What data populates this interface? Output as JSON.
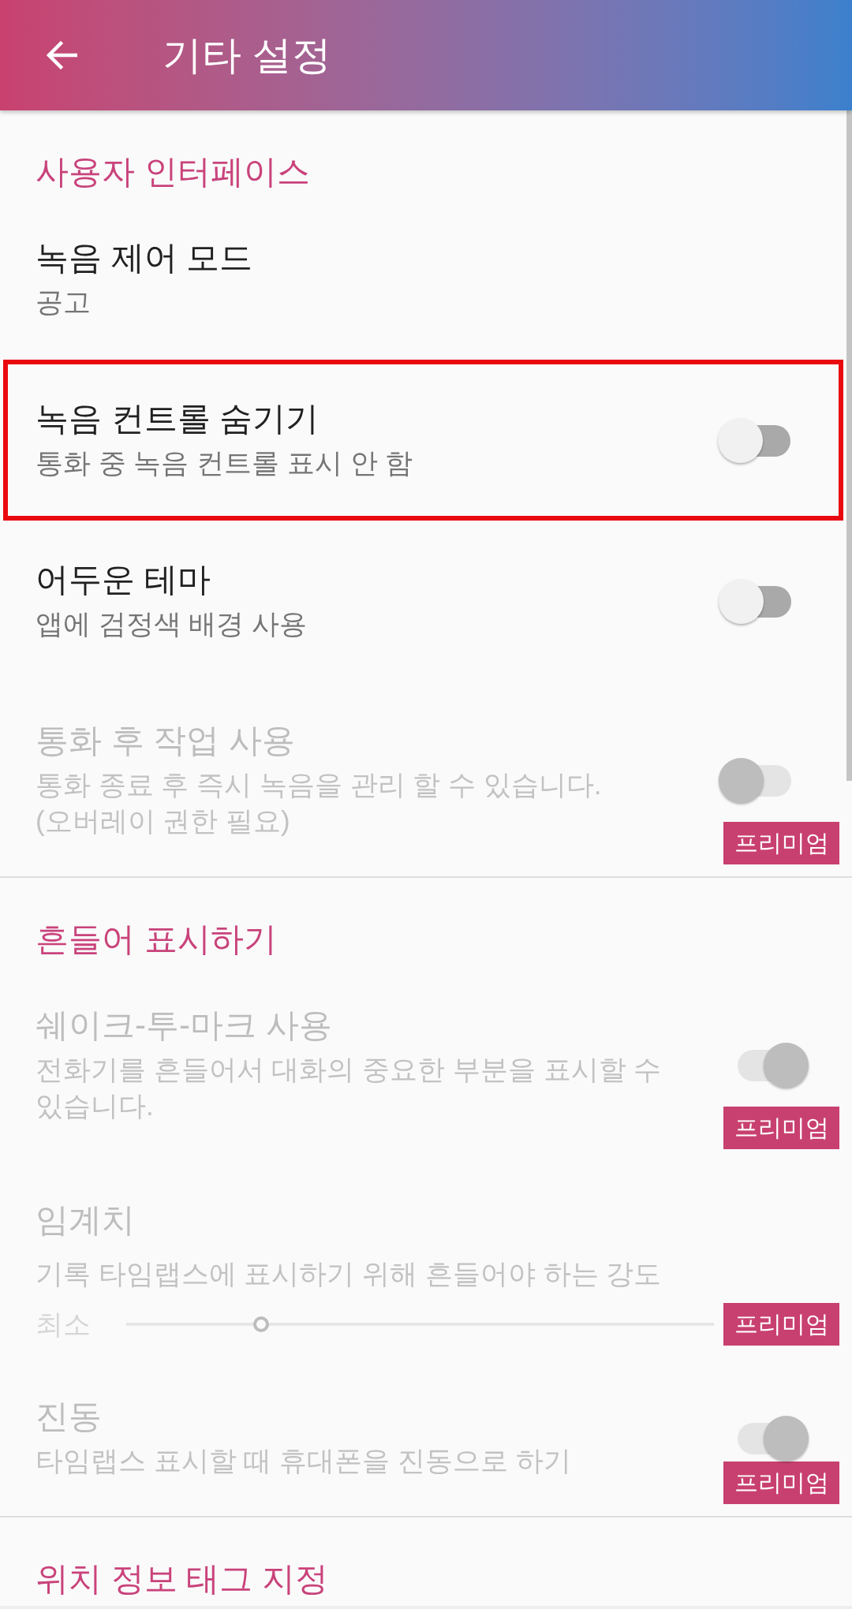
{
  "app_bar": {
    "title": "기타 설정"
  },
  "sections": [
    {
      "header": "사용자 인터페이스",
      "items": [
        {
          "kind": "text",
          "title": "녹음 제어 모드",
          "summary": "공고",
          "disabled": false,
          "highlighted": false
        },
        {
          "kind": "switch",
          "title": "녹음 컨트롤 숨기기",
          "summary": "통화 중 녹음 컨트롤 표시 안 함",
          "on": false,
          "disabled": false,
          "highlighted": true
        },
        {
          "kind": "switch",
          "title": "어두운 테마",
          "summary": "앱에 검정색 배경 사용",
          "on": false,
          "disabled": false,
          "highlighted": false
        },
        {
          "kind": "switch",
          "title": "통화 후 작업 사용",
          "summary": "통화 종료 후 즉시 녹음을 관리 할 수 있습니다.\n(오버레이 권한 필요)",
          "on": false,
          "disabled": true,
          "highlighted": false,
          "badge": "프리미엄"
        }
      ]
    },
    {
      "header": "흔들어 표시하기",
      "items": [
        {
          "kind": "switch",
          "title": "쉐이크-투-마크 사용",
          "summary": "전화기를 흔들어서 대화의 중요한 부분을 표시할 수 있습니다.",
          "on": true,
          "disabled": true,
          "highlighted": false,
          "badge": "프리미엄"
        },
        {
          "kind": "slider",
          "title": "임계치",
          "summary": "기록 타임랩스에 표시하기 위해 흔들어야 하는 강도",
          "min_label": "최소",
          "level": 0.23,
          "disabled": true,
          "highlighted": false,
          "badge": "프리미엄"
        },
        {
          "kind": "switch",
          "title": "진동",
          "summary": "타임랩스 표시할 때 휴대폰을 진동으로 하기",
          "on": true,
          "disabled": true,
          "highlighted": false,
          "badge": "프리미엄"
        }
      ]
    },
    {
      "header": "위치 정보 태그 지정"
    }
  ]
}
